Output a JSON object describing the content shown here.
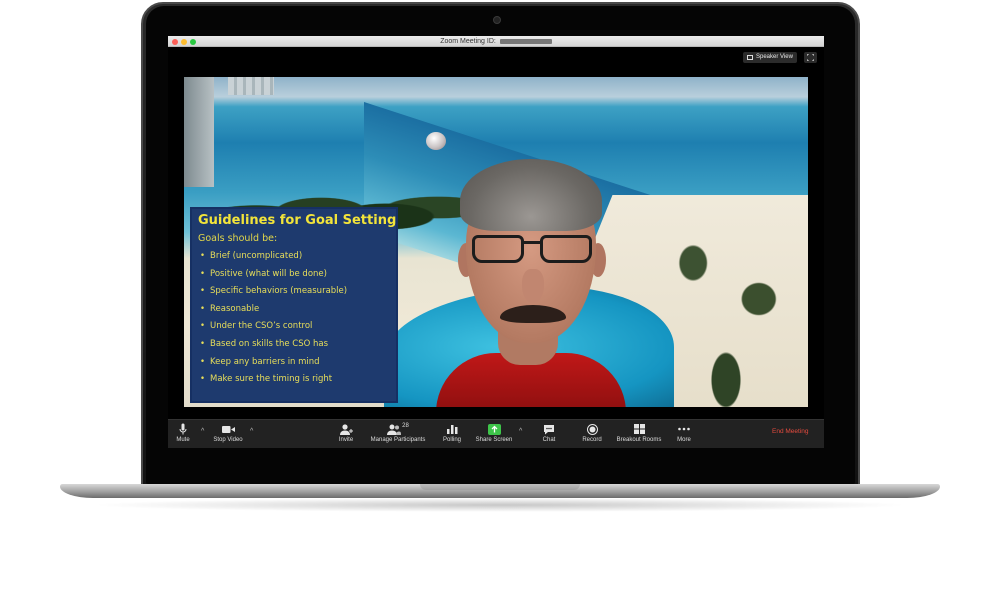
{
  "window": {
    "title": "Zoom Meeting ID:",
    "speaker_view_label": "Speaker View"
  },
  "slide": {
    "title": "Guidelines for Goal Setting",
    "subtitle": "Goals should be:",
    "items": [
      "Brief (uncomplicated)",
      "Positive (what will be done)",
      "Specific behaviors (measurable)",
      "Reasonable",
      "Under the CSO’s control",
      "Based on skills the CSO has",
      "Keep any barriers in mind",
      "Make sure the timing is right"
    ]
  },
  "toolbar": {
    "mute": "Mute",
    "stop_video": "Stop Video",
    "invite": "Invite",
    "manage_participants": "Manage Participants",
    "participant_count": "28",
    "polling": "Polling",
    "share_screen": "Share Screen",
    "chat": "Chat",
    "record": "Record",
    "breakout_rooms": "Breakout Rooms",
    "more": "More",
    "end_meeting": "End Meeting"
  },
  "colors": {
    "share_screen_green": "#3ec54a",
    "end_meeting_red": "#e44b3e",
    "slide_background": "#1e3a6e",
    "slide_text": "#f2e43a"
  },
  "icons": {
    "mute": "microphone-icon",
    "stop_video": "video-camera-icon",
    "invite": "add-person-icon",
    "participants": "participants-icon",
    "polling": "bar-chart-icon",
    "share": "share-screen-icon",
    "chat": "chat-bubble-icon",
    "record": "record-icon",
    "breakout": "grid-icon",
    "more": "ellipsis-icon"
  }
}
